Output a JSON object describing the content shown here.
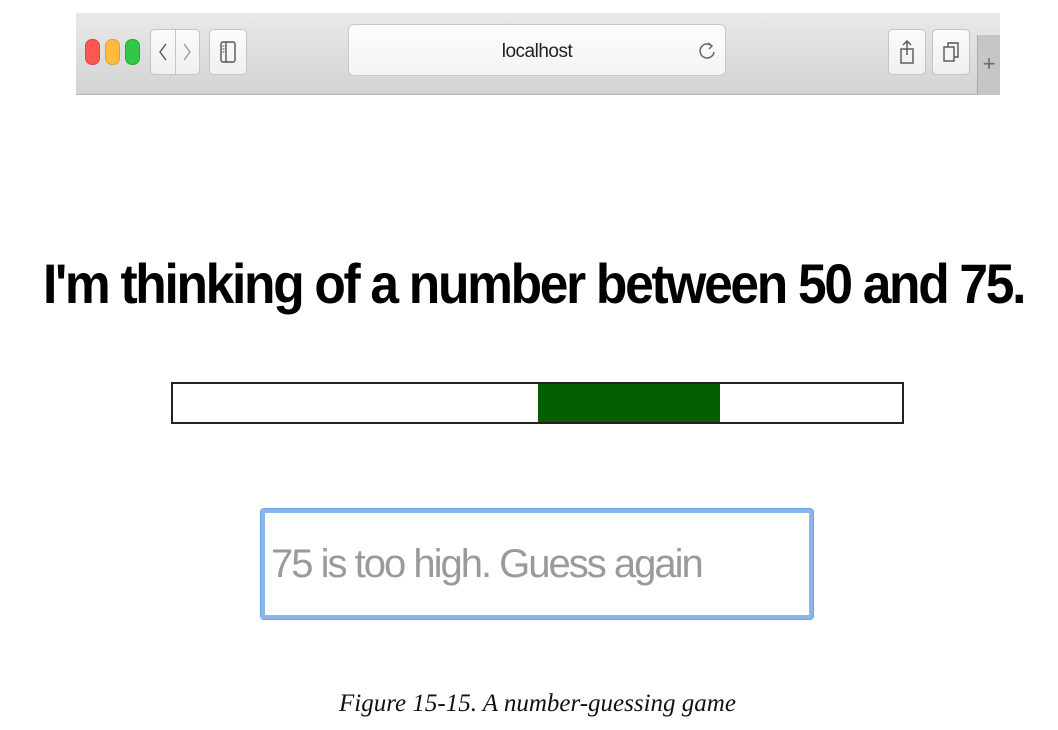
{
  "browser": {
    "address": "localhost",
    "new_tab_glyph": "+",
    "icons": [
      "back-icon",
      "forward-icon",
      "sidebar-icon",
      "reload-icon",
      "share-icon",
      "tabs-icon",
      "new-tab-icon"
    ]
  },
  "game": {
    "message": "I'm thinking of a number between 50 and 75.",
    "range": {
      "min": 0,
      "max": 100,
      "low": 50,
      "high": 75
    },
    "fill_color": "#035f02",
    "input_placeholder": "75 is too high. Guess again",
    "input_value": ""
  },
  "caption": "Figure 15-15. A number-guessing game"
}
